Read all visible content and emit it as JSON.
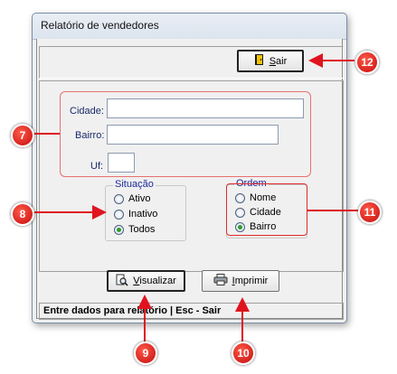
{
  "window": {
    "title": "Relatório de vendedores"
  },
  "toolbar": {
    "exit_label_prefix": "",
    "exit_label_mnemonic": "S",
    "exit_label_rest": "air"
  },
  "filters": {
    "city_label": "Cidade:",
    "city_value": "",
    "district_label": "Bairro:",
    "district_value": "",
    "state_label": "Uf:",
    "state_value": ""
  },
  "situation": {
    "legend": "Situação",
    "options": [
      {
        "label": "Ativo",
        "selected": false
      },
      {
        "label": "Inativo",
        "selected": false
      },
      {
        "label": "Todos",
        "selected": true
      }
    ]
  },
  "order": {
    "legend": "Ordem",
    "options": [
      {
        "label": "Nome",
        "selected": false
      },
      {
        "label": "Cidade",
        "selected": false
      },
      {
        "label": "Bairro",
        "selected": true
      }
    ]
  },
  "actions": {
    "preview_mnemonic": "V",
    "preview_rest": "isualizar",
    "print_mnemonic": "I",
    "print_rest": "mprimir"
  },
  "status": {
    "text": "Entre dados para relatório | Esc - Sair"
  },
  "callouts": [
    "12",
    "7",
    "8",
    "11",
    "9",
    "10"
  ],
  "colors": {
    "callout": "#d9190f",
    "arrow": "#e0141e",
    "accent_radio": "#2c9c2c"
  }
}
